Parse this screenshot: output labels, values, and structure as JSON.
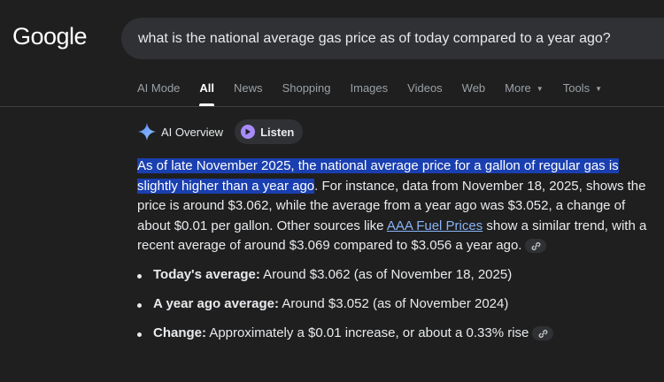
{
  "logo": "Google",
  "search": {
    "query": "what is the national average gas price as of today compared to a year ago?"
  },
  "tabs": [
    {
      "label": "AI Mode"
    },
    {
      "label": "All"
    },
    {
      "label": "News"
    },
    {
      "label": "Shopping"
    },
    {
      "label": "Images"
    },
    {
      "label": "Videos"
    },
    {
      "label": "Web"
    },
    {
      "label": "More"
    },
    {
      "label": "Tools"
    }
  ],
  "active_tab": "All",
  "ai_overview": {
    "label": "AI Overview",
    "listen_label": "Listen",
    "highlighted_text": "As of late November 2025, the national average price for a gallon of regular gas is slightly higher than a year ago",
    "text_after_highlight": ". For instance, data from November 18, 2025, shows the price is around $3.062, while the average from a year ago was $3.052, a change of about $0.01 per gallon. Other sources like ",
    "link_text": "AAA Fuel Prices",
    "text_after_link": " show a similar trend, with a recent average of around $3.069 compared to $3.056 a year ago."
  },
  "bullets": [
    {
      "label": "Today's average:",
      "text": " Around $3.062 (as of November 18, 2025)"
    },
    {
      "label": "A year ago average:",
      "text": " Around $3.052 (as of November 2024)"
    },
    {
      "label": "Change:",
      "text": " Approximately a $0.01 increase, or about a 0.33% rise"
    }
  ],
  "colors": {
    "background": "#1f1f1f",
    "highlight": "#1a3fb0",
    "link": "#8ab4f8",
    "listen_icon": "#a78bfa"
  },
  "icons": {
    "sparkle": "ai-sparkle-icon",
    "play": "play-icon",
    "link_chip": "link-icon",
    "dropdown": "caret-down-icon"
  }
}
